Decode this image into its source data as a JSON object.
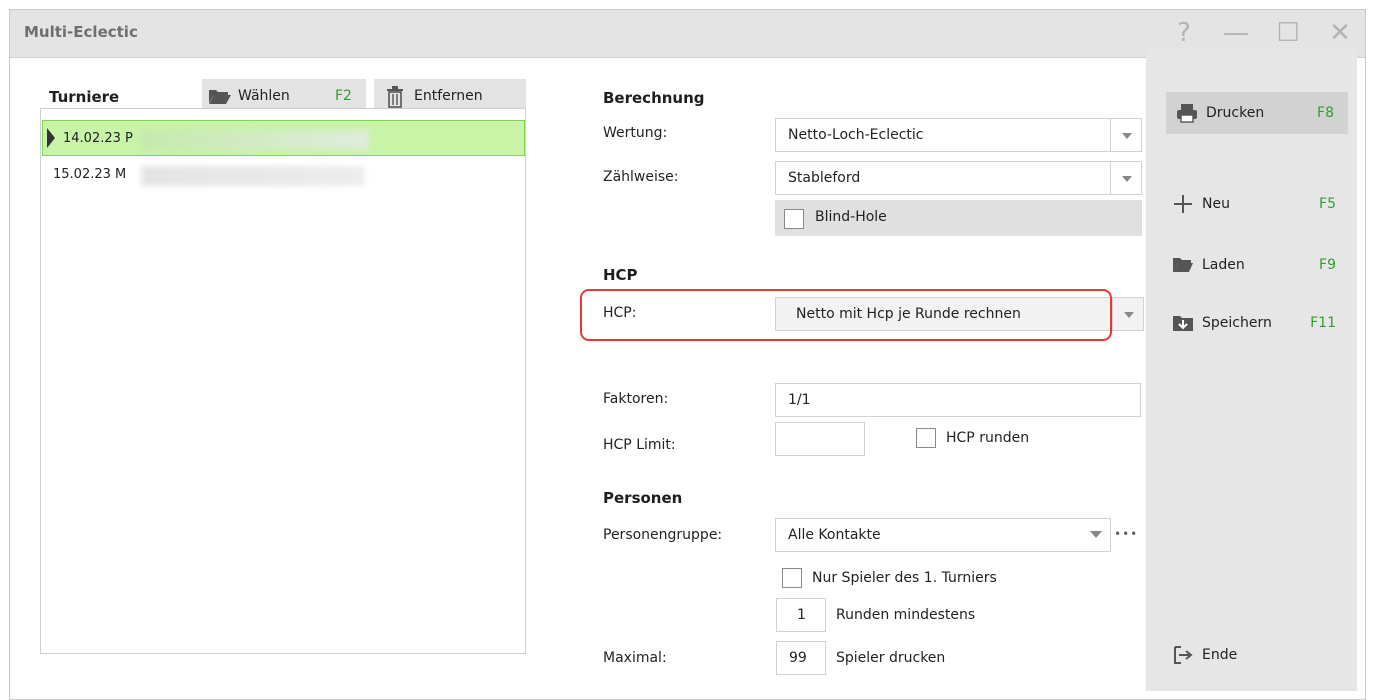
{
  "window": {
    "title": "Multi-Eclectic",
    "help": "?",
    "minimize": "—",
    "maximize": "☐",
    "close": "✕"
  },
  "tournaments": {
    "label": "Turniere",
    "choose_label": "Wählen",
    "choose_key": "F2",
    "remove_label": "Entfernen",
    "rows": [
      {
        "date": "14.02.23 P"
      },
      {
        "date": "15.02.23 M"
      }
    ]
  },
  "berechnung": {
    "section": "Berechnung",
    "wertung_label": "Wertung:",
    "wertung_value": "Netto-Loch-Eclectic",
    "zaehlweise_label": "Zählweise:",
    "zaehlweise_value": "Stableford",
    "blind_hole_label": "Blind-Hole"
  },
  "hcp": {
    "section": "HCP",
    "hcp_label": "HCP:",
    "hcp_value": "Netto mit Hcp je Runde rechnen",
    "faktoren_label": "Faktoren:",
    "faktoren_value": "1/1",
    "limit_label": "HCP Limit:",
    "limit_value": "",
    "runden_label": "HCP runden"
  },
  "personen": {
    "section": "Personen",
    "gruppe_label": "Personengruppe:",
    "gruppe_value": "Alle Kontakte",
    "more": "•••",
    "nur_spieler_label": "Nur Spieler des 1. Turniers",
    "runden_value": "1",
    "runden_label": "Runden mindestens",
    "maximal_label": "Maximal:",
    "maximal_value": "99",
    "spieler_label": "Spieler drucken"
  },
  "side": {
    "print_label": "Drucken",
    "print_key": "F8",
    "new_label": "Neu",
    "new_key": "F5",
    "load_label": "Laden",
    "load_key": "F9",
    "save_label": "Speichern",
    "save_key": "F11",
    "end_label": "Ende"
  }
}
